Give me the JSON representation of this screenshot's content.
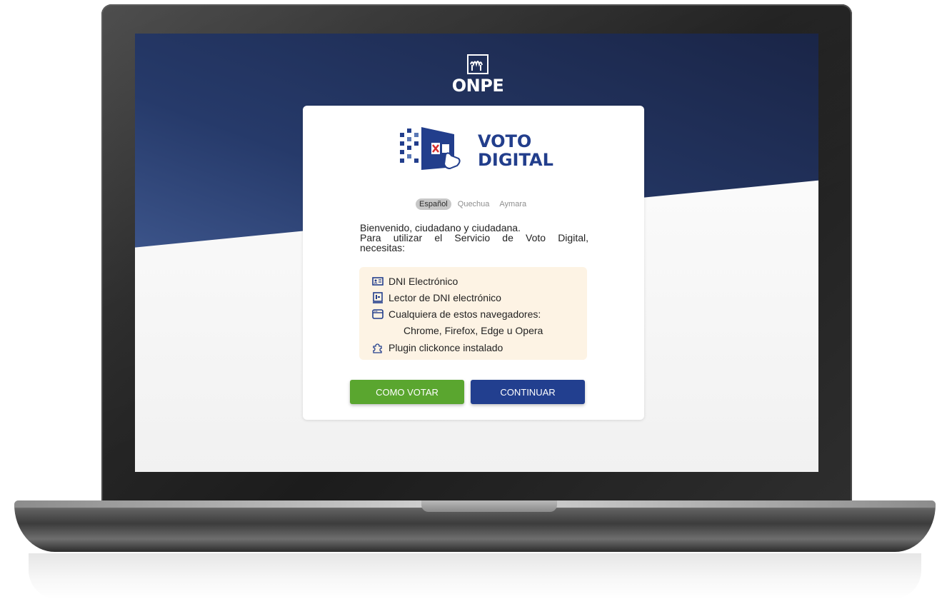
{
  "header": {
    "org_name": "ONPE"
  },
  "brand": {
    "title_line1": "VOTO",
    "title_line2": "DIGITAL"
  },
  "languages": [
    {
      "label": "Español",
      "active": true
    },
    {
      "label": "Quechua",
      "active": false
    },
    {
      "label": "Aymara",
      "active": false
    }
  ],
  "welcome": {
    "line1": "Bienvenido, ciudadano y ciudadana.",
    "line2": "Para utilizar el Servicio de Voto Digital,",
    "line3": "necesitas:"
  },
  "requirements": {
    "items": [
      {
        "icon": "id-card-icon",
        "label": "DNI Electrónico"
      },
      {
        "icon": "card-reader-icon",
        "label": "Lector de DNI electrónico"
      },
      {
        "icon": "browser-window-icon",
        "label": "Cualquiera de estos navegadores:"
      },
      {
        "icon": "puzzle-piece-icon",
        "label": "Plugin clickonce instalado"
      }
    ],
    "browsers": "Chrome, Firefox, Edge u Opera"
  },
  "buttons": {
    "how_to_vote": "COMO VOTAR",
    "continue": "CONTINUAR"
  },
  "colors": {
    "header_blue": "#1a2547",
    "brand_blue": "#223e8c",
    "green": "#5aa62f",
    "requirements_bg": "#fdf3e4"
  }
}
